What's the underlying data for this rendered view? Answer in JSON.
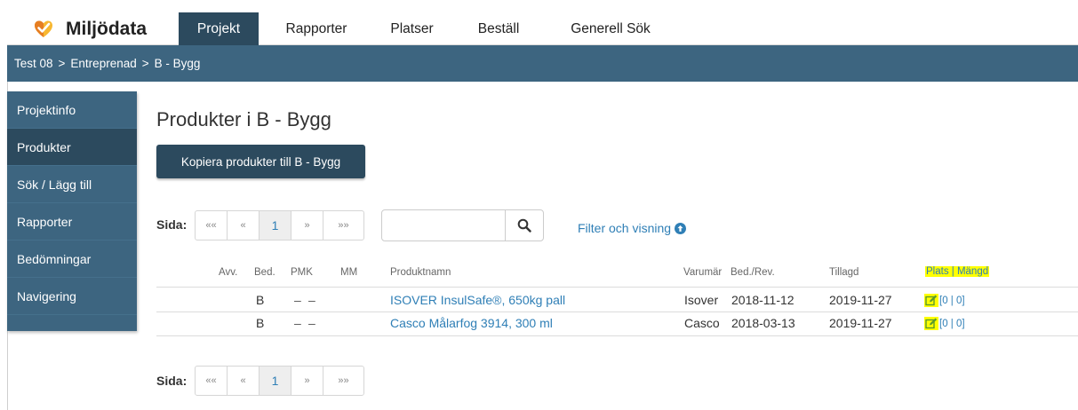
{
  "app": {
    "name": "Miljödata",
    "logo_icon": "heart-check-logo"
  },
  "nav": {
    "tabs": [
      {
        "label": "Projekt",
        "active": true
      },
      {
        "label": "Rapporter"
      },
      {
        "label": "Platser"
      },
      {
        "label": "Beställ"
      },
      {
        "label": "Generell Sök"
      }
    ]
  },
  "breadcrumb": {
    "items": [
      "Test 08",
      "Entreprenad",
      "B - Bygg"
    ],
    "separator": ">"
  },
  "sidebar": {
    "items": [
      {
        "label": "Projektinfo"
      },
      {
        "label": "Produkter",
        "active": true
      },
      {
        "label": "Sök / Lägg till"
      },
      {
        "label": "Rapporter"
      },
      {
        "label": "Bedömningar"
      },
      {
        "label": "Navigering"
      }
    ]
  },
  "main": {
    "title": "Produkter i B - Bygg",
    "copy_button": "Kopiera produkter till B - Bygg",
    "pager": {
      "label": "Sida:",
      "first": "««",
      "prev": "«",
      "current": "1",
      "next": "»",
      "last": "»»"
    },
    "search": {
      "value": "",
      "placeholder": "",
      "icon": "search-icon"
    },
    "filter_link": "Filter och visning",
    "filter_icon": "arrow-up-circle-icon"
  },
  "table": {
    "headers": {
      "avv": "Avv.",
      "bed": "Bed.",
      "pmk": "PMK",
      "mm": "MM",
      "produktnamn": "Produktnamn",
      "varumarke": "Varumär",
      "bedrev": "Bed./Rev.",
      "tillagd": "Tillagd",
      "plats": "Plats | Mängd"
    },
    "rows": [
      {
        "avv": "",
        "bed": "B",
        "pmk": "–",
        "mm": "–",
        "produktnamn": "ISOVER InsulSafe®, 650kg pall",
        "varumarke": "Isover",
        "bedrev": "2018-11-12",
        "tillagd": "2019-11-27",
        "plats": "[0 | 0]"
      },
      {
        "avv": "",
        "bed": "B",
        "pmk": "–",
        "mm": "–",
        "produktnamn": "Casco Målarfog 3914, 300 ml",
        "varumarke": "Casco",
        "bedrev": "2018-03-13",
        "tillagd": "2019-11-27",
        "plats": "[0 | 0]"
      }
    ]
  },
  "colors": {
    "nav_dark": "#2c4a5e",
    "nav_mid": "#3d6580",
    "link": "#2f7fb6",
    "highlight": "#ffff00",
    "logo_orange": "#f39c12"
  }
}
